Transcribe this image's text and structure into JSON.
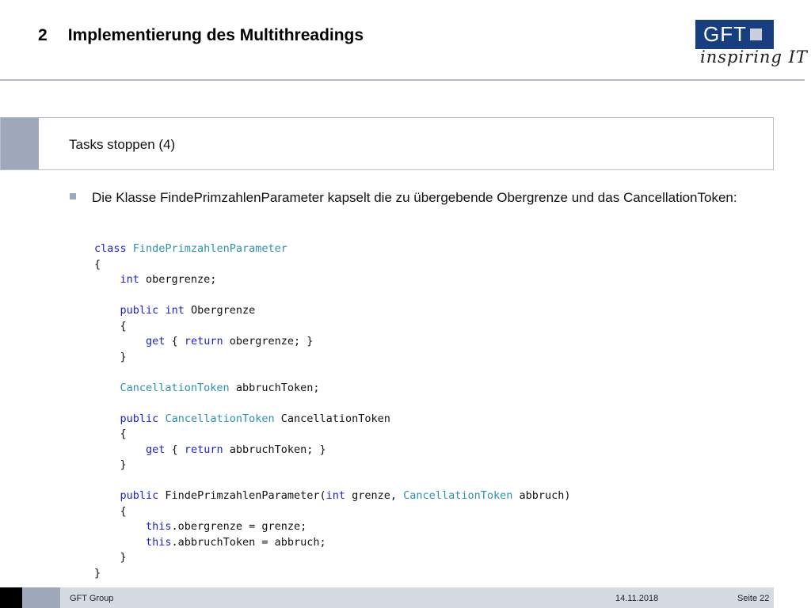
{
  "header": {
    "section_number": "2",
    "title": "Implementierung des Multithreadings"
  },
  "logo": {
    "text": "GFT",
    "tagline": "inspiring IT",
    "colors": {
      "box": "#173f7f",
      "square": "#c9d0dc"
    }
  },
  "section": {
    "title": "Tasks stoppen (4)"
  },
  "bullet": {
    "text": "Die Klasse FindePrimzahlenParameter kapselt die zu übergebende Obergrenze und das CancellationToken:"
  },
  "code_lines": [
    [
      [
        "kw",
        "class"
      ],
      [
        "t",
        " "
      ],
      [
        "type",
        "FindePrimzahlenParameter"
      ]
    ],
    [
      [
        "t",
        "{"
      ]
    ],
    [
      [
        "t",
        "    "
      ],
      [
        "kw",
        "int"
      ],
      [
        "t",
        " obergrenze;"
      ]
    ],
    [
      [
        "t",
        ""
      ]
    ],
    [
      [
        "t",
        "    "
      ],
      [
        "kw",
        "public"
      ],
      [
        "t",
        " "
      ],
      [
        "kw",
        "int"
      ],
      [
        "t",
        " Obergrenze"
      ]
    ],
    [
      [
        "t",
        "    {"
      ]
    ],
    [
      [
        "t",
        "        "
      ],
      [
        "kw",
        "get"
      ],
      [
        "t",
        " { "
      ],
      [
        "kw",
        "return"
      ],
      [
        "t",
        " obergrenze; }"
      ]
    ],
    [
      [
        "t",
        "    }"
      ]
    ],
    [
      [
        "t",
        ""
      ]
    ],
    [
      [
        "t",
        "    "
      ],
      [
        "type",
        "CancellationToken"
      ],
      [
        "t",
        " abbruchToken;"
      ]
    ],
    [
      [
        "t",
        ""
      ]
    ],
    [
      [
        "t",
        "    "
      ],
      [
        "kw",
        "public"
      ],
      [
        "t",
        " "
      ],
      [
        "type",
        "CancellationToken"
      ],
      [
        "t",
        " CancellationToken"
      ]
    ],
    [
      [
        "t",
        "    {"
      ]
    ],
    [
      [
        "t",
        "        "
      ],
      [
        "kw",
        "get"
      ],
      [
        "t",
        " { "
      ],
      [
        "kw",
        "return"
      ],
      [
        "t",
        " abbruchToken; }"
      ]
    ],
    [
      [
        "t",
        "    }"
      ]
    ],
    [
      [
        "t",
        ""
      ]
    ],
    [
      [
        "t",
        "    "
      ],
      [
        "kw",
        "public"
      ],
      [
        "t",
        " FindePrimzahlenParameter("
      ],
      [
        "kw",
        "int"
      ],
      [
        "t",
        " grenze, "
      ],
      [
        "type",
        "CancellationToken"
      ],
      [
        "t",
        " abbruch)"
      ]
    ],
    [
      [
        "t",
        "    {"
      ]
    ],
    [
      [
        "t",
        "        "
      ],
      [
        "kw",
        "this"
      ],
      [
        "t",
        ".obergrenze = grenze;"
      ]
    ],
    [
      [
        "t",
        "        "
      ],
      [
        "kw",
        "this"
      ],
      [
        "t",
        ".abbruchToken = abbruch;"
      ]
    ],
    [
      [
        "t",
        "    }"
      ]
    ],
    [
      [
        "t",
        "}"
      ]
    ]
  ],
  "footer": {
    "company": "GFT Group",
    "date": "14.11.2018",
    "page": "Seite 22"
  },
  "colors": {
    "accent": "#9ea8b8",
    "keyword": "#1d21d6",
    "type": "#2b91af"
  }
}
